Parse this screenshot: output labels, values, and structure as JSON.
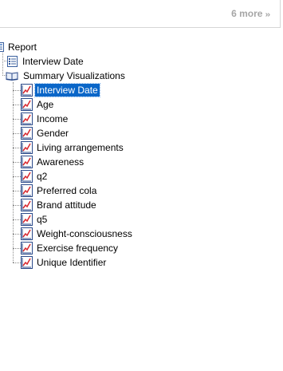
{
  "toolbar": {
    "more_label": "6 more"
  },
  "tree": {
    "root": {
      "label": "Report",
      "icon": "report-icon"
    },
    "children": [
      {
        "label": "Interview Date",
        "icon": "list-icon"
      },
      {
        "label": "Summary Visualizations",
        "icon": "book-icon"
      }
    ],
    "visualizations": [
      {
        "label": "Interview Date",
        "selected": true
      },
      {
        "label": "Age"
      },
      {
        "label": "Income"
      },
      {
        "label": "Gender"
      },
      {
        "label": "Living arrangements"
      },
      {
        "label": "Awareness"
      },
      {
        "label": "q2"
      },
      {
        "label": "Preferred cola"
      },
      {
        "label": "Brand attitude"
      },
      {
        "label": "q5"
      },
      {
        "label": "Weight-consciousness"
      },
      {
        "label": "Exercise frequency"
      },
      {
        "label": "Unique Identifier"
      }
    ]
  },
  "colors": {
    "selection": "#0a66c8",
    "chart_icon_line": "#d9272e",
    "chart_icon_frame": "#2b4a8a"
  }
}
